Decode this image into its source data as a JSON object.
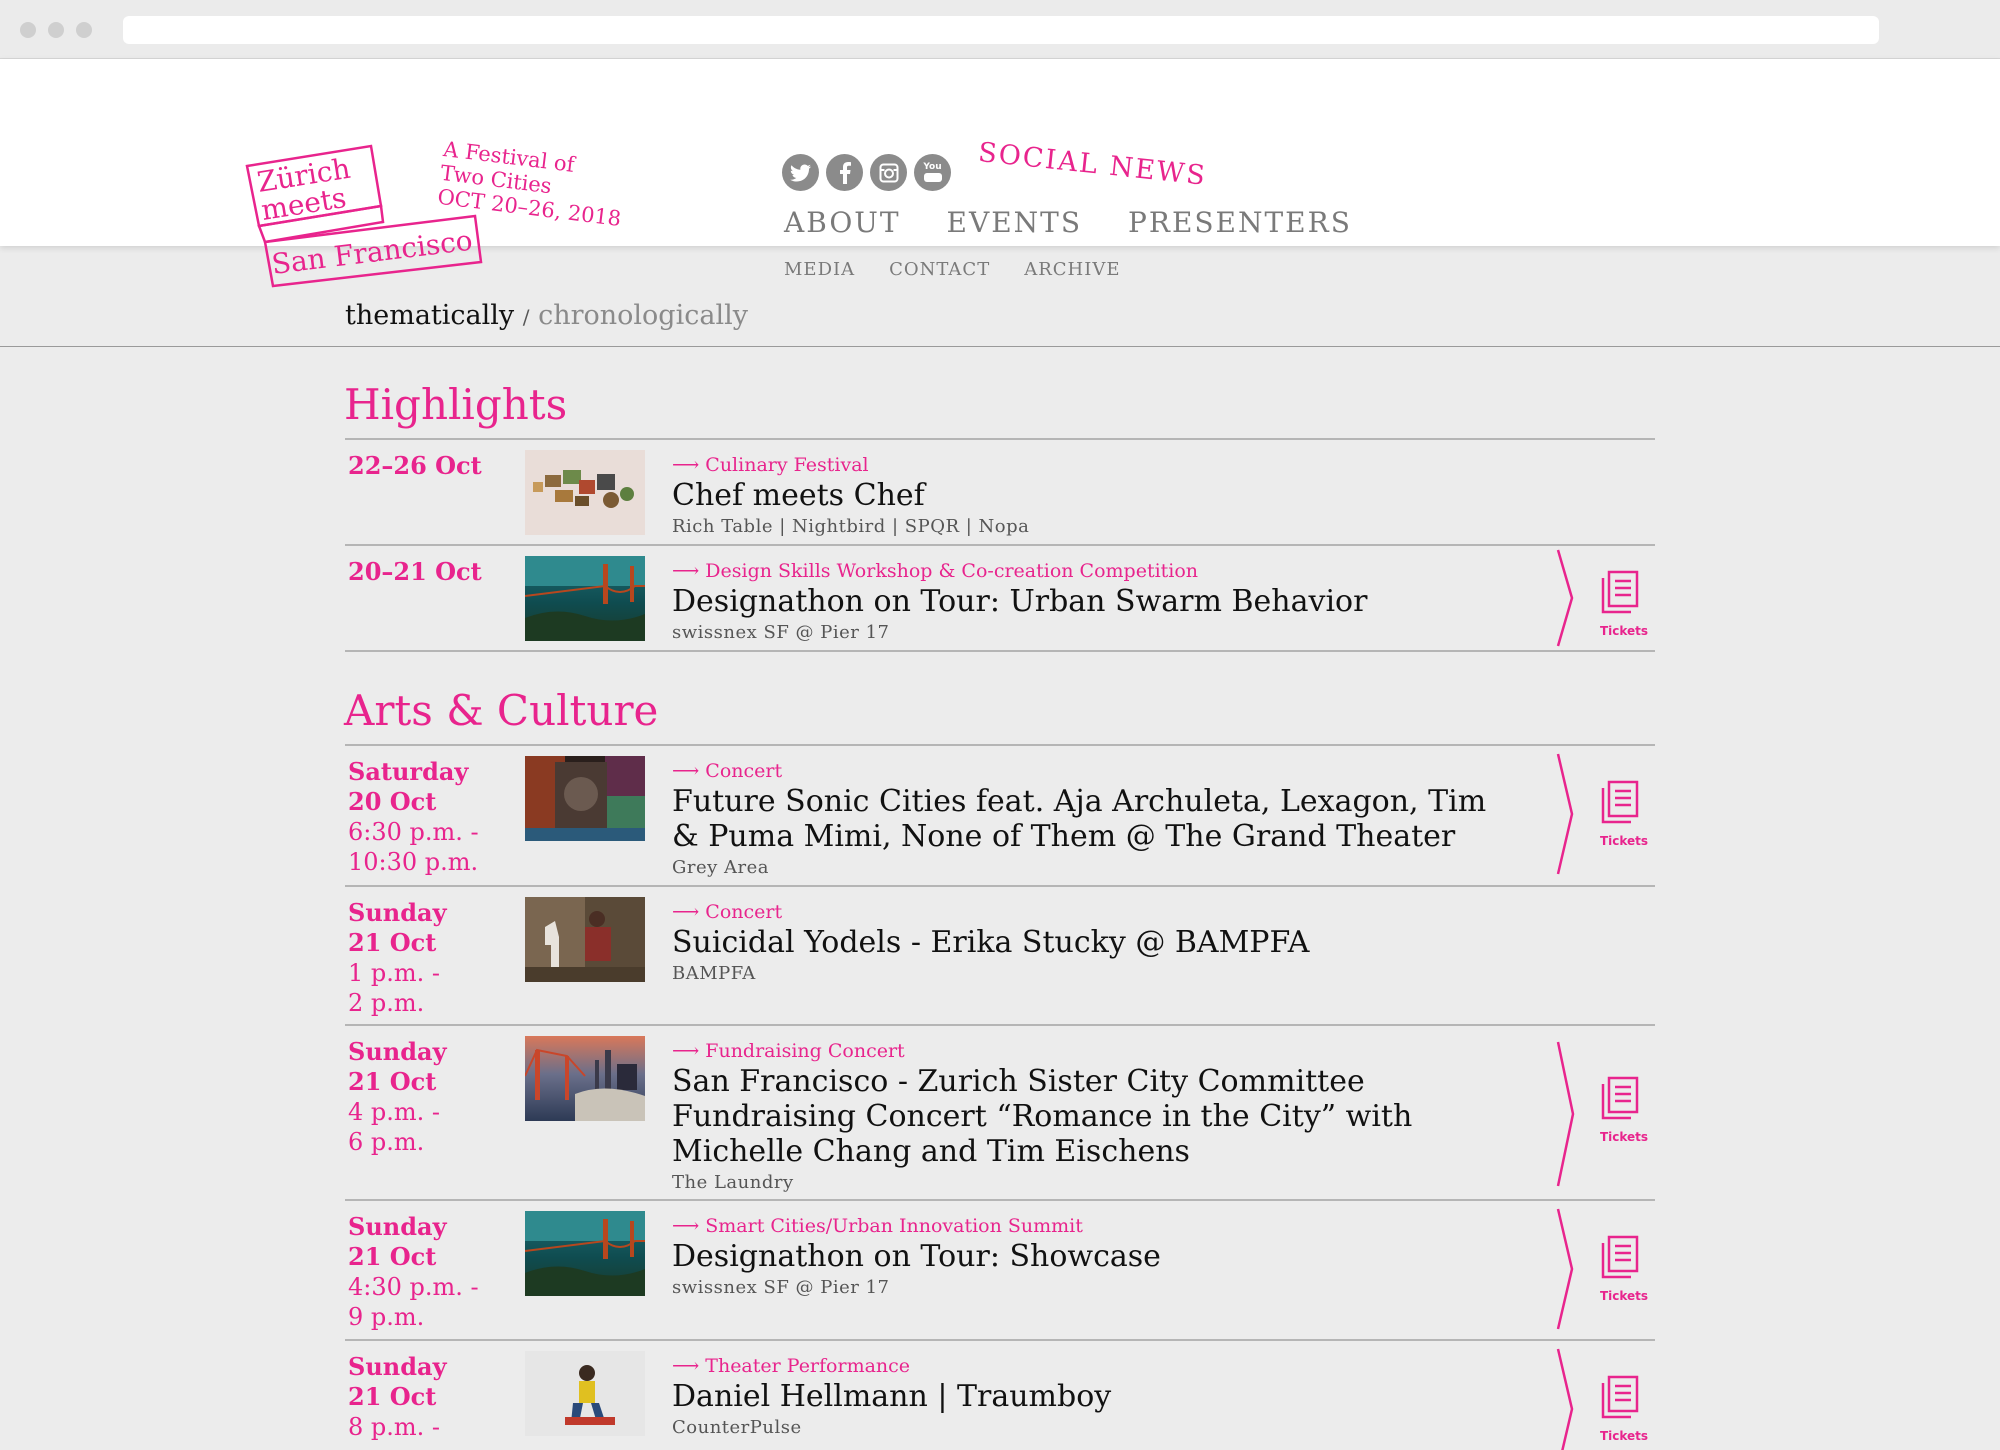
{
  "logo": {
    "line1": "Zürich",
    "line2": "meets",
    "line3": "San Francisco"
  },
  "tagline": {
    "line1": "A Festival of",
    "line2": "Two Cities",
    "line3": "OCT 20–26, 2018"
  },
  "social": {
    "icons": [
      "twitter-icon",
      "facebook-icon",
      "instagram-icon",
      "youtube-icon"
    ],
    "youtube_text": "You",
    "news_label": "SOCIAL NEWS"
  },
  "nav": {
    "main": [
      "ABOUT",
      "EVENTS",
      "PRESENTERS"
    ],
    "sub": [
      "MEDIA",
      "CONTACT",
      "ARCHIVE"
    ]
  },
  "view": {
    "active": "thematically",
    "separator": "/",
    "inactive": "chronologically"
  },
  "sections": [
    {
      "title": "Highlights",
      "events": [
        {
          "date_bold": "22–26 Oct",
          "time": "",
          "category": "⟶ Culinary Festival",
          "title": "Chef meets Chef",
          "venue": "Rich Table | Nightbird | SPQR | Nopa",
          "tickets": false
        },
        {
          "date_bold": "20–21 Oct",
          "time": "",
          "category": "⟶ Design Skills Workshop & Co-creation Competition",
          "title": "Designathon on Tour: Urban Swarm Behavior",
          "venue": "swissnex SF @ Pier 17",
          "tickets": true
        }
      ]
    },
    {
      "title": "Arts & Culture",
      "events": [
        {
          "date_bold": "Saturday",
          "date_bold2": "20 Oct",
          "time": "6:30 p.m. -",
          "time2": "10:30 p.m.",
          "category": "⟶ Concert",
          "title": "Future Sonic Cities feat. Aja Archuleta, Lexagon, Tim & Puma Mimi, None of Them @ The Grand Theater",
          "venue": "Grey Area",
          "tickets": true
        },
        {
          "date_bold": "Sunday",
          "date_bold2": "21 Oct",
          "time": "1 p.m. -",
          "time2": "2 p.m.",
          "category": "⟶ Concert",
          "title": "Suicidal Yodels - Erika Stucky @ BAMPFA",
          "venue": "BAMPFA",
          "tickets": false
        },
        {
          "date_bold": "Sunday",
          "date_bold2": "21 Oct",
          "time": "4 p.m. -",
          "time2": "6 p.m.",
          "category": "⟶ Fundraising Concert",
          "title": "San Francisco - Zurich Sister City Committee Fundraising Concert “Romance in the City” with Michelle Chang and Tim Eischens",
          "venue": "The Laundry",
          "tickets": true
        },
        {
          "date_bold": "Sunday",
          "date_bold2": "21 Oct",
          "time": "4:30 p.m. -",
          "time2": "9 p.m.",
          "category": "⟶ Smart Cities/Urban Innovation Summit",
          "title": "Designathon on Tour: Showcase",
          "venue": "swissnex SF @ Pier 17",
          "tickets": true
        },
        {
          "date_bold": "Sunday",
          "date_bold2": "21 Oct",
          "time": "8 p.m. -",
          "time2": "",
          "category": "⟶ Theater Performance",
          "title": "Daniel Hellmann | Traumboy",
          "venue": "CounterPulse",
          "tickets": true
        }
      ]
    }
  ],
  "tickets_label": "Tickets",
  "colors": {
    "accent": "#e8248d",
    "nav_gray": "#7a7a7a",
    "background": "#ececec"
  }
}
